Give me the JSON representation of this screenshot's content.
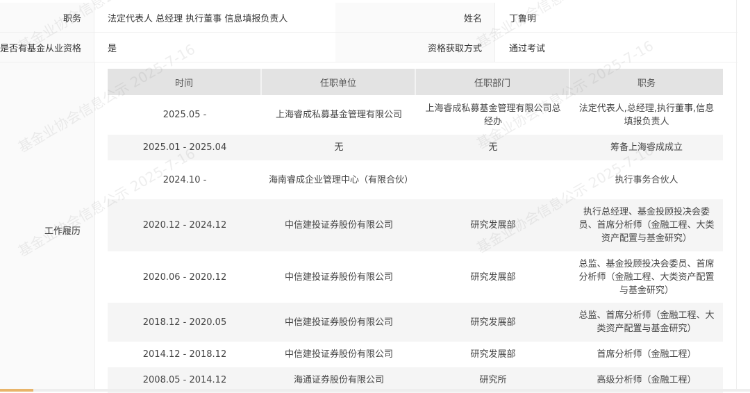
{
  "info": {
    "position_label": "职务",
    "position_value": "法定代表人 总经理 执行董事 信息填报负责人",
    "name_label": "姓名",
    "name_value": "丁鲁明",
    "qualification_label": "是否有基金从业资格",
    "qualification_value": "是",
    "method_label": "资格获取方式",
    "method_value": "通过考试",
    "work_label": "工作履历"
  },
  "work_table": {
    "headers": [
      "时间",
      "任职单位",
      "任职部门",
      "职务"
    ],
    "rows": [
      [
        "2025.05 -",
        "上海睿成私募基金管理有限公司",
        "上海睿成私募基金管理有限公司总经办",
        "法定代表人,总经理,执行董事,信息填报负责人"
      ],
      [
        "2025.01 - 2025.04",
        "无",
        "无",
        "筹备上海睿成成立"
      ],
      [
        "2024.10 -",
        "海南睿成企业管理中心（有限合伙）",
        "",
        "执行事务合伙人"
      ],
      [
        "2020.12 - 2024.12",
        "中信建投证券股份有限公司",
        "研究发展部",
        "执行总经理、基金投顾投决会委员、首席分析师（金融工程、大类资产配置与基金研究）"
      ],
      [
        "2020.06 - 2020.12",
        "中信建投证券股份有限公司",
        "研究发展部",
        "总监、基金投顾投决会委员、首席分析师（金融工程、大类资产配置与基金研究）"
      ],
      [
        "2018.12 - 2020.05",
        "中信建投证券股份有限公司",
        "研究发展部",
        "总监、首席分析师（金融工程、大类资产配置与基金研究）"
      ],
      [
        "2014.12 - 2018.12",
        "中信建投证券股份有限公司",
        "研究发展部",
        "首席分析师（金融工程）"
      ],
      [
        "2008.05 - 2014.12",
        "海通证券股份有限公司",
        "研究所",
        "高级分析师（金融工程）"
      ]
    ]
  },
  "watermark": {
    "text_a": "基金业协会信息公示 2025-7-16",
    "text_b": "基金业协会信息公示 2025-7-16"
  }
}
